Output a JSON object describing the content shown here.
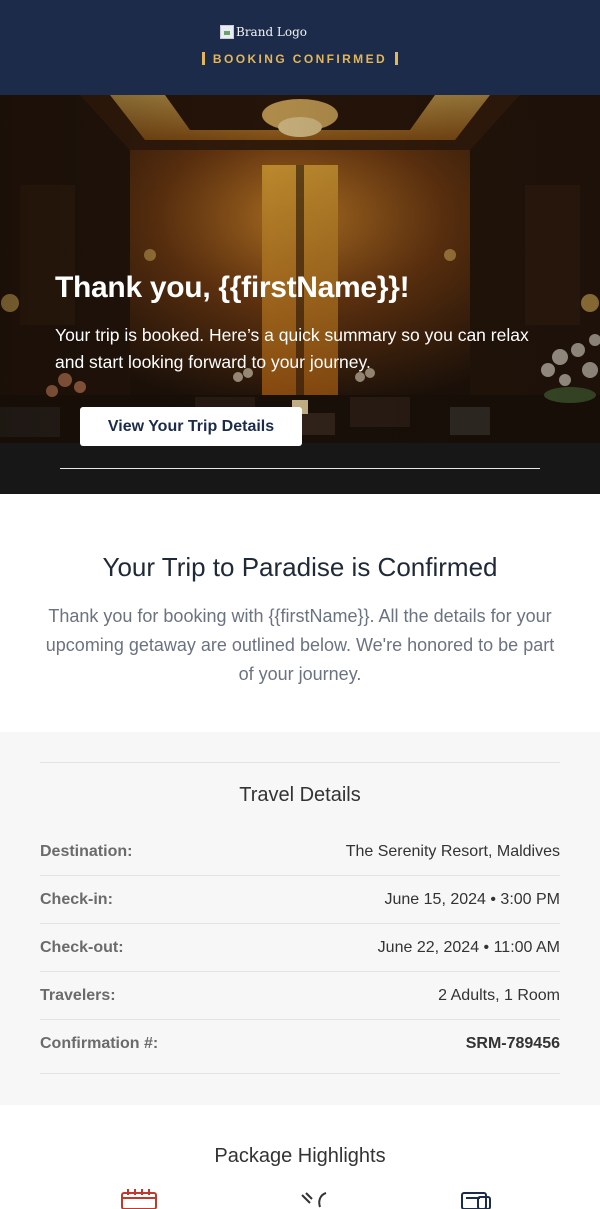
{
  "header": {
    "logo_alt": "Brand Logo",
    "badge": "BOOKING CONFIRMED"
  },
  "hero": {
    "title": "Thank you, {{firstName}}!",
    "text": "Your trip is booked. Here’s a quick summary so you can relax and start looking forward to your journey.",
    "button_label": "View Your Trip Details"
  },
  "confirm": {
    "title": "Your Trip to Paradise is Confirmed",
    "text": "Thank you for booking with {{firstName}}. All the details for your upcoming getaway are outlined below. We're honored to be part of your journey."
  },
  "travel": {
    "title": "Travel Details",
    "rows": [
      {
        "label": "Destination:",
        "value": "The Serenity Resort, Maldives"
      },
      {
        "label": "Check-in:",
        "value": "June 15, 2024 • 3:00 PM"
      },
      {
        "label": "Check-out:",
        "value": "June 22, 2024 • 11:00 AM"
      },
      {
        "label": "Travelers:",
        "value": "2 Adults, 1 Room"
      },
      {
        "label": "Confirmation #:",
        "value": "SRM-789456"
      }
    ]
  },
  "highlights": {
    "title": "Package Highlights",
    "icons": [
      "calendar-icon",
      "spa-icon",
      "ticket-icon"
    ]
  },
  "colors": {
    "header_bg": "#1c2b4a",
    "accent_gold": "#e4b656",
    "section_bg": "#f7f7f7"
  }
}
